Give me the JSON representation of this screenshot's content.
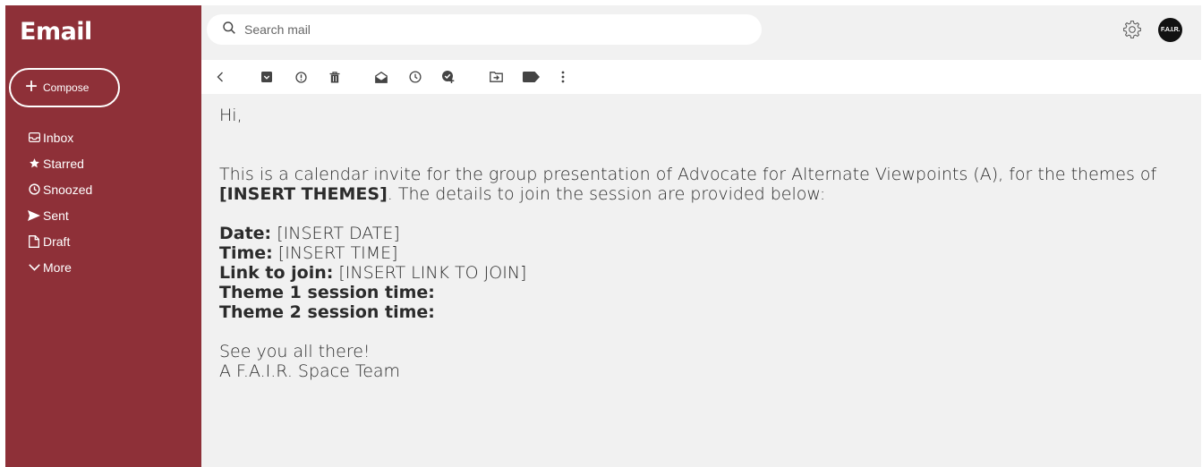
{
  "app": {
    "title": "Email"
  },
  "compose": {
    "label": "Compose"
  },
  "nav": {
    "items": [
      {
        "label": "Inbox",
        "icon": "inbox-icon"
      },
      {
        "label": "Starred",
        "icon": "star-icon"
      },
      {
        "label": "Snoozed",
        "icon": "clock-icon"
      },
      {
        "label": "Sent",
        "icon": "send-icon"
      },
      {
        "label": "Draft",
        "icon": "draft-icon"
      },
      {
        "label": "More",
        "icon": "chevron-down-icon"
      }
    ]
  },
  "search": {
    "placeholder": "Search mail"
  },
  "avatar": {
    "text": "F.A.I.R."
  },
  "toolbar": {
    "icons": [
      "back-icon",
      "archive-icon",
      "report-spam-icon",
      "delete-icon",
      "mark-unread-icon",
      "snooze-icon",
      "add-task-icon",
      "move-to-icon",
      "label-icon",
      "more-vert-icon"
    ]
  },
  "email": {
    "greeting": "Hi,",
    "intro_1": "This is a calendar invite for the group presentation of Advocate for Alternate Viewpoints (A), for the themes of ",
    "themes": "[INSERT THEMES]",
    "intro_2": ". The details to join the session are provided below:",
    "date_label": "Date:",
    "date_value": " [INSERT DATE]",
    "time_label": "Time:",
    "time_value": " [INSERT TIME]",
    "link_label": "Link to join:",
    "link_value": " [INSERT LINK TO JOIN]",
    "theme1_label": "Theme 1 session time:",
    "theme2_label": "Theme 2 session time:",
    "signoff": "See you all there!",
    "signature": "A F.A.I.R. Space Team"
  },
  "colors": {
    "sidebar": "#8e3038",
    "main_bg": "#f1f1f1",
    "text": "#2b2b2b"
  }
}
